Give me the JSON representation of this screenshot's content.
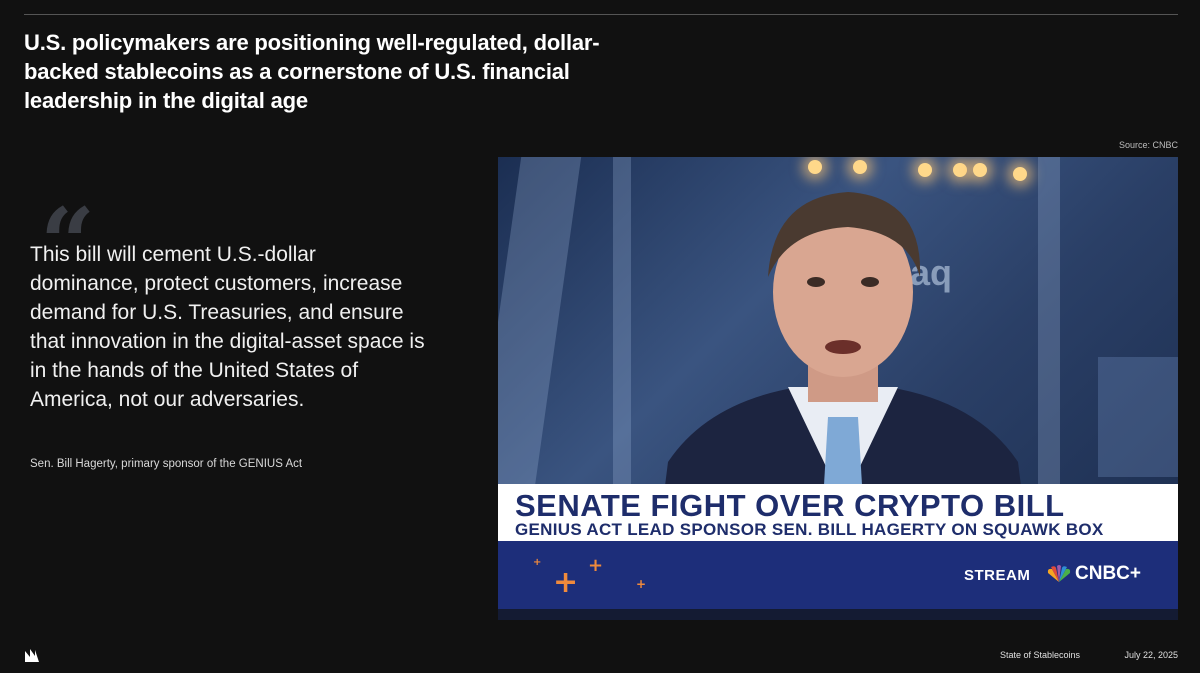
{
  "headline": "U.S. policymakers are positioning well-regulated, dollar-backed stablecoins as a cornerstone of U.S. financial leadership in the digital age",
  "source": "Source: CNBC",
  "quote": {
    "mark": "“",
    "text": "This bill will cement U.S.-dollar dominance, protect customers, increase demand for U.S. Treasuries, and ensure that innovation in the digital-asset space is in the hands of the United States of America, not our adversaries.",
    "attribution": "Sen. Bill Hagerty, primary sponsor of the GENIUS Act"
  },
  "video": {
    "background_text": "sdaq",
    "lower_third_title": "SENATE FIGHT OVER CRYPTO BILL",
    "lower_third_subtitle": "GENIUS ACT LEAD SPONSOR SEN. BILL HAGERTY ON SQUAWK BOX",
    "stream_label": "STREAM",
    "network_label": "CNBC+",
    "icons": [
      "peacock-icon",
      "plus-icon"
    ],
    "colors": {
      "navy": "#1e2d6b",
      "ticker": "#1d2e7a",
      "orange": "#f08a3c"
    }
  },
  "footer": {
    "report_title": "State of Stablecoins",
    "date": "July 22, 2025",
    "logo_icon": "brand-logo-icon"
  },
  "colors": {
    "background": "#111111",
    "text": "#ffffff"
  }
}
